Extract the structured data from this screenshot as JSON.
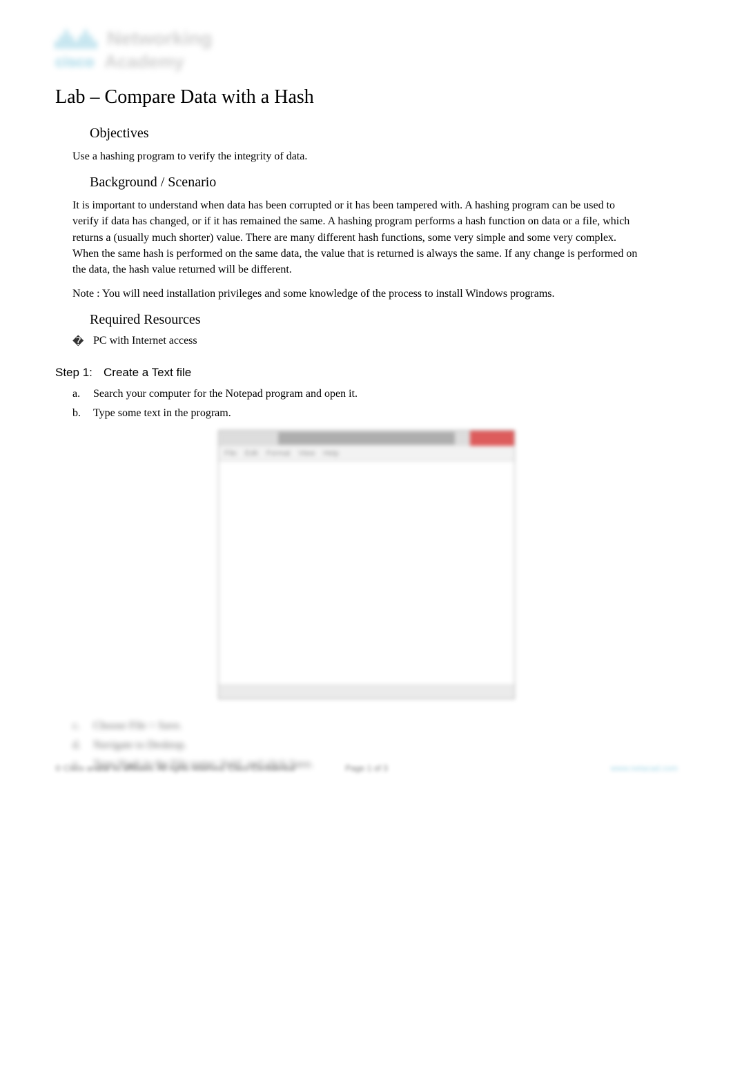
{
  "logo": {
    "brand": "cisco",
    "line1": "Networking",
    "line2": "Academy"
  },
  "title": "Lab – Compare Data with a Hash",
  "sections": {
    "objectives": {
      "heading": "Objectives",
      "text": "Use a hashing program to verify the integrity of data."
    },
    "background": {
      "heading": "Background / Scenario",
      "paragraph": "It is important to understand when data has been corrupted or it has been tampered with. A hashing program can be used to verify if data has changed, or if it has remained the same. A hashing program performs a hash function on data or a file, which returns a (usually much shorter) value. There are many different hash functions, some very simple and some very complex. When the same hash is performed on the same data, the value that is returned is always the same. If any change is performed on the data, the hash value returned will be different.",
      "note": "Note : You will need installation privileges and some knowledge of the process to install Windows programs."
    },
    "resources": {
      "heading": "Required Resources",
      "items": [
        "PC with Internet access"
      ]
    }
  },
  "step1": {
    "label": "Step 1:",
    "title": "Create a Text file",
    "items": [
      {
        "marker": "a.",
        "text": "Search your computer for the Notepad program and open it."
      },
      {
        "marker": "b.",
        "text": "Type some text in the program."
      }
    ],
    "blurred_items": [
      {
        "marker": "c.",
        "text": "Choose File > Save."
      },
      {
        "marker": "d.",
        "text": "Navigate to Desktop."
      },
      {
        "marker": "e.",
        "text": "Type Hash in the File name: field, and click Save."
      }
    ]
  },
  "notepad": {
    "menu": [
      "File",
      "Edit",
      "Format",
      "View",
      "Help"
    ]
  },
  "footer": {
    "left": "© Cisco and/or its affiliates. All rights reserved. Cisco Confidential",
    "center": "Page 1 of 3",
    "right": "www.netacad.com"
  }
}
